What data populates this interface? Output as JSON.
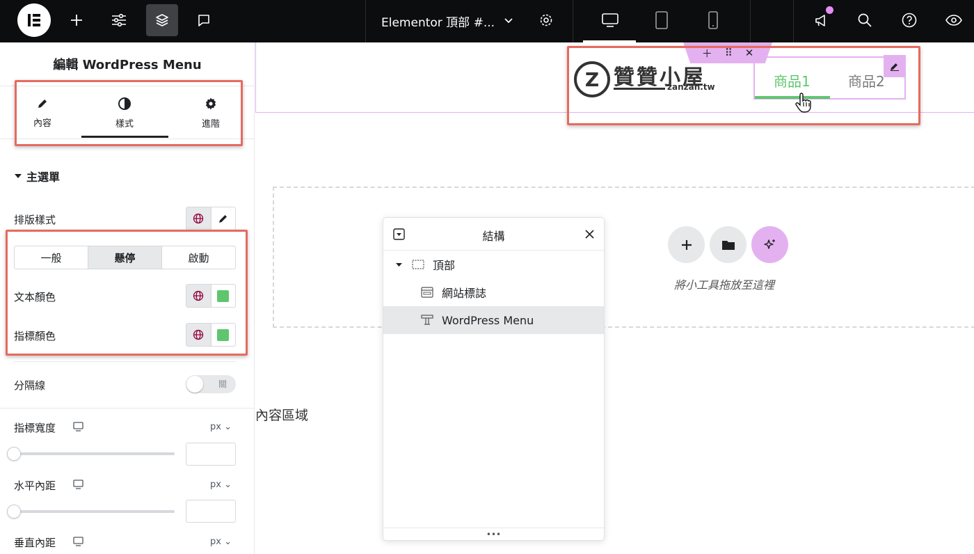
{
  "topbar": {
    "document_title": "Elementor 頂部 #...",
    "accent_dot_color": "#e48ef5"
  },
  "panel": {
    "title": "編輯 WordPress Menu",
    "tabs": [
      {
        "label": "內容",
        "icon": "pencil-icon"
      },
      {
        "label": "樣式",
        "icon": "half-circle-icon",
        "active": true
      },
      {
        "label": "進階",
        "icon": "gear-icon"
      }
    ],
    "section_title": "主選單",
    "typography_label": "排版樣式",
    "state_tabs": [
      "一般",
      "懸停",
      "啟動"
    ],
    "active_state": "懸停",
    "text_color_label": "文本顏色",
    "pointer_color_label": "指標顏色",
    "swatch_color": "#5fc66e",
    "divider_label": "分隔線",
    "divider_toggle": "關",
    "pointer_width_label": "指標寬度",
    "h_padding_label": "水平內距",
    "v_padding_label": "垂直內距",
    "unit": "px"
  },
  "canvas": {
    "logo_text": "贊贊小屋",
    "logo_sub": "zanzan.tw",
    "menu_items": [
      "商品1",
      "商品2"
    ],
    "drop_text": "將小工具拖放至這裡",
    "content_label": "內容區域"
  },
  "structure": {
    "title": "結構",
    "items": [
      "頂部",
      "網站標誌",
      "WordPress Menu"
    ]
  }
}
